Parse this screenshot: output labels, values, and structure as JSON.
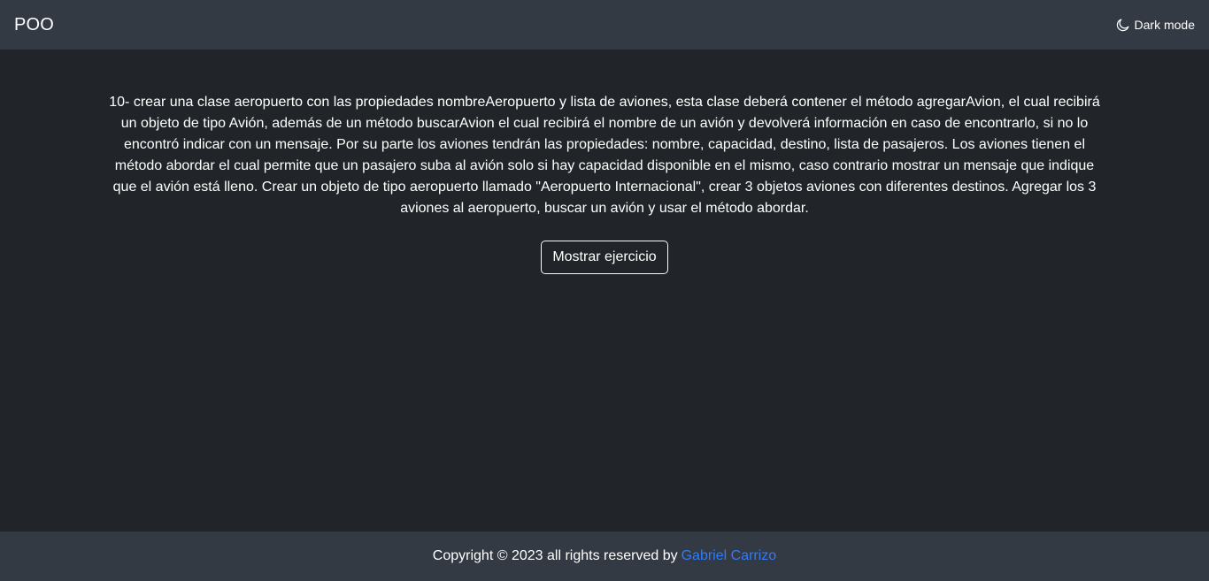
{
  "navbar": {
    "brand": "POO",
    "theme_toggle_label": "Dark mode",
    "theme_icon": "moon-icon"
  },
  "main": {
    "statement": "10- crear una clase aeropuerto con las propiedades nombreAeropuerto y lista de aviones, esta clase deberá contener el método agregarAvion, el cual recibirá un objeto de tipo Avión, además de un método buscarAvion el cual recibirá el nombre de un avión y devolverá información en caso de encontrarlo, si no lo encontró indicar con un mensaje. Por su parte los aviones tendrán las propiedades: nombre, capacidad, destino, lista de pasajeros. Los aviones tienen el método abordar el cual permite que un pasajero suba al avión solo si hay capacidad disponible en el mismo, caso contrario mostrar un mensaje que indique que el avión está lleno. Crear un objeto de tipo aeropuerto llamado \"Aeropuerto Internacional\", crear 3 objetos aviones con diferentes destinos. Agregar los 3 aviones al aeropuerto, buscar un avión y usar el método abordar.",
    "show_button_label": "Mostrar ejercicio"
  },
  "footer": {
    "copyright_text": "Copyright © 2023 all rights reserved by",
    "author_link": "Gabriel Carrizo"
  },
  "colors": {
    "background": "#212529",
    "bars": "#343a44",
    "link": "#2f7cf6",
    "text": "#ffffff"
  }
}
